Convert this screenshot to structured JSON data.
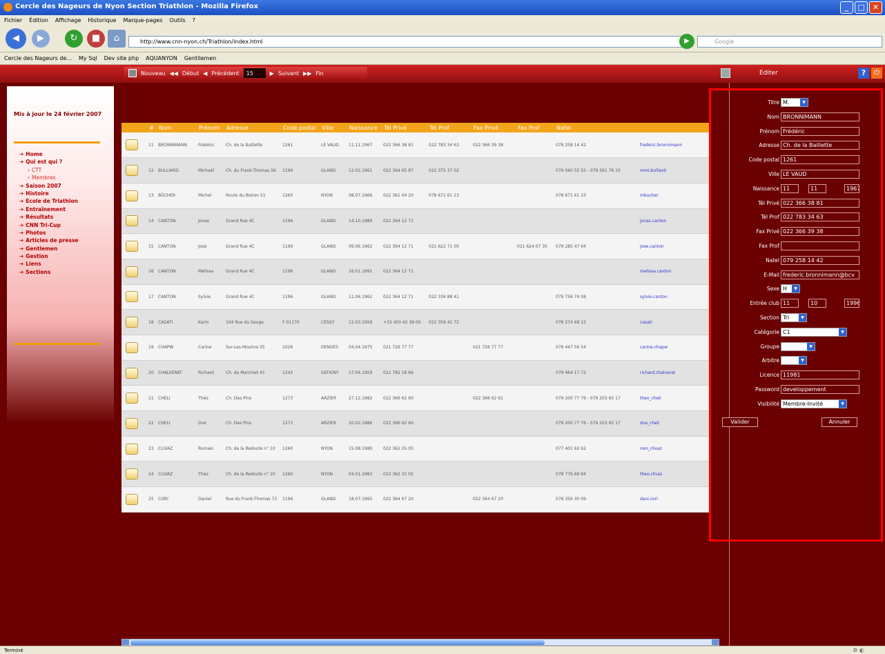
{
  "window": {
    "title": "Cercle des Nageurs de Nyon Section Triathlon - Mozilla Firefox"
  },
  "menu": [
    "Fichier",
    "Édition",
    "Affichage",
    "Historique",
    "Marque-pages",
    "Outils",
    "?"
  ],
  "navigation": {
    "url": "http://www.cnn-nyon.ch/Triathlon/index.html",
    "search_placeholder": "Google"
  },
  "bookmarks": [
    "Cercle des Nageurs de...",
    "My Sql",
    "Dev site php",
    "AQUANYON",
    "Gentilemen"
  ],
  "toolbar": {
    "nouveau": "Nouveau",
    "debut": "Début",
    "precedent": "Précédent",
    "page_size": "15",
    "suivant": "Suivant",
    "fin": "Fin",
    "edit_label": "Editer",
    "help": "?"
  },
  "sidebar": {
    "updated": "Mis à jour le 24 février 2007",
    "items": [
      {
        "label": "Home",
        "sub": false
      },
      {
        "label": "Qui est qui ?",
        "sub": false
      },
      {
        "label": "CTT",
        "sub": true
      },
      {
        "label": "Membres",
        "sub": true
      },
      {
        "label": "Saison 2007",
        "sub": false
      },
      {
        "label": "Histoire",
        "sub": false
      },
      {
        "label": "Ecole de Triathlon",
        "sub": false
      },
      {
        "label": "Entraînement",
        "sub": false
      },
      {
        "label": "Résultats",
        "sub": false
      },
      {
        "label": "CNN Tri-Cup",
        "sub": false
      },
      {
        "label": "Photos",
        "sub": false
      },
      {
        "label": "Articles de presse",
        "sub": false
      },
      {
        "label": "Gentlemen",
        "sub": false
      },
      {
        "label": "Gestion",
        "sub": false
      },
      {
        "label": "Liens",
        "sub": false
      },
      {
        "label": "Sections",
        "sub": false
      }
    ]
  },
  "table": {
    "headers": [
      "",
      "#",
      "Nom",
      "Prénom",
      "Adresse",
      "Code postal",
      "Ville",
      "Naissance",
      "Tél Privé",
      "Tél Prof",
      "Fax Privé",
      "Fax Prof",
      "Natel",
      ""
    ],
    "rows": [
      [
        "11",
        "BRONNIMANN",
        "Frédéric",
        "Ch. de la Baillette",
        "1261",
        "LE VAUD",
        "11.11.1967",
        "022 366 38 81",
        "022 783 34 63",
        "022 366 39 38",
        "",
        "079 258 14 42",
        "frederic.bronnimann"
      ],
      [
        "12",
        "BULLIARD",
        "Michaël",
        "Ch. du Frank-Thomas 56",
        "1196",
        "GLAND",
        "12.02.1961",
        "022 364 65 87",
        "022 375 37 02",
        "",
        "",
        "079 560 55 52 - 079 561 76 10",
        "mmi.bulliard"
      ],
      [
        "13",
        "BÜCHER",
        "Michel",
        "Route du Boiron 51",
        "1260",
        "NYON",
        "08.07.1966",
        "022 361 04 20",
        "078 671 61 23",
        "",
        "",
        "078 671 61 23",
        "mbucher"
      ],
      [
        "14",
        "CANTON",
        "Jonas",
        "Grand Rue 4C",
        "1196",
        "GLAND",
        "14.10.1989",
        "022 364 12 71",
        "",
        "",
        "",
        "",
        "jonas.canton"
      ],
      [
        "15",
        "CANTON",
        "José",
        "Grand Rue 4C",
        "1196",
        "GLAND",
        "09.06.1962",
        "022 364 12 71",
        "021 622 71 00",
        "",
        "021 624 07 35",
        "079 285 47 64",
        "jose.canton"
      ],
      [
        "16",
        "CANTON",
        "Mélissa",
        "Grand Rue 4C",
        "1196",
        "GLAND",
        "16.01.1991",
        "022 364 12 71",
        "",
        "",
        "",
        "",
        "melissa.canton"
      ],
      [
        "17",
        "CANTON",
        "Sylvie",
        "Grand Rue 4C",
        "1196",
        "GLAND",
        "11.06.1962",
        "022 364 12 71",
        "022 336 88 41",
        "",
        "",
        "079 756 74 08",
        "sylvie.canton"
      ],
      [
        "18",
        "CASATI",
        "Karin",
        "104 Rue du Sauge",
        "F-01170",
        "CESSY",
        "12.03.1959",
        "+33 450 42 39 00",
        "022 359 41 72",
        "",
        "",
        "078 274 69 12",
        "casati"
      ],
      [
        "19",
        "CHAPW",
        "Carine",
        "Sur-Les-Moulins 35",
        "1026",
        "DENGES",
        "04.04.1975",
        "021 726 77 77",
        "",
        "021 726 77 77",
        "",
        "079 447 56 54",
        "carine.chapw"
      ],
      [
        "20",
        "CHALVERAT",
        "Richard",
        "Ch. de Marcinet 41",
        "1242",
        "SATIGNY",
        "17.04.1959",
        "022 782 16 66",
        "",
        "",
        "",
        "079 464 17 72",
        "richard.chalverat"
      ],
      [
        "21",
        "CHELI",
        "Théo",
        "Ch. Des Pins",
        "1273",
        "ARZIER",
        "27.12.1982",
        "022 366 62 60",
        "",
        "022 366 62 61",
        "",
        "079 200 77 76 - 079 203 65 17",
        "theo_cheli"
      ],
      [
        "22",
        "CHELI",
        "Dvé",
        "Ch. Des Pins",
        "1273",
        "ARZIER",
        "20.02.1986",
        "022 366 62 60",
        "",
        "",
        "",
        "079 200 77 76 - 079 203 65 17",
        "dve_cheli"
      ],
      [
        "23",
        "CLIVAZ",
        "Romain",
        "Ch. de la Redoute n° 10",
        "1260",
        "NYON",
        "15.08.1980",
        "022 362 25 05",
        "",
        "",
        "",
        "077 401 62 62",
        "rom_clivaz"
      ],
      [
        "24",
        "CLIVAZ",
        "Théo",
        "Ch. de la Redoute n° 10",
        "1260",
        "NYON",
        "04.01.1983",
        "022 362 25 05",
        "",
        "",
        "",
        "078 776 69 94",
        "theo.clivaz"
      ],
      [
        "25",
        "CORI",
        "Daniel",
        "Rue du Frank-Thomas 73",
        "1196",
        "GLAND",
        "18.07.1965",
        "022 364 67 20",
        "",
        "022 364 67 20",
        "",
        "078 356 30 09",
        "dani.cori"
      ]
    ]
  },
  "form": {
    "titre": {
      "label": "Titre",
      "value": "M."
    },
    "nom": {
      "label": "Nom",
      "value": "BRONNIMANN"
    },
    "prenom": {
      "label": "Prénom",
      "value": "Frédéric"
    },
    "adresse": {
      "label": "Adresse",
      "value": "Ch. de la Baillette"
    },
    "code_postal": {
      "label": "Code postal",
      "value": "1261"
    },
    "ville": {
      "label": "Ville",
      "value": "LE VAUD"
    },
    "naissance": {
      "label": "Naissance",
      "day": "11",
      "month": "11",
      "year": "1967"
    },
    "tel_prive": {
      "label": "Tél Privé",
      "value": "022 366 38 81"
    },
    "tel_prof": {
      "label": "Tél Prof",
      "value": "022 783 34 63"
    },
    "fax_prive": {
      "label": "Fax Privé",
      "value": "022 366 39 38"
    },
    "fax_prof": {
      "label": "Fax Prof",
      "value": ""
    },
    "natel": {
      "label": "Natel",
      "value": "079 258 14 42"
    },
    "email": {
      "label": "E-Mail",
      "value": "frederic.bronnimann@bcv"
    },
    "sexe": {
      "label": "Sexe",
      "value": "H"
    },
    "entree_club": {
      "label": "Entrée club",
      "day": "11",
      "month": "10",
      "year": "1996"
    },
    "section": {
      "label": "Section",
      "value": "Tri"
    },
    "categorie": {
      "label": "Catégorie",
      "value": "C1"
    },
    "groupe": {
      "label": "Groupe",
      "value": ""
    },
    "arbitre": {
      "label": "Arbitre",
      "value": ""
    },
    "licence": {
      "label": "Licence",
      "value": "11981"
    },
    "password": {
      "label": "Password",
      "value": "developpement"
    },
    "visibilite": {
      "label": "Visibilité",
      "value": "Membre-Invité"
    },
    "valider": "Valider",
    "annuler": "Annuler"
  },
  "status": {
    "text": "Terminé"
  },
  "colors": {
    "app_bg": "#6a0000",
    "header_orange": "#f2a41a",
    "toolbar_red": "#c01818",
    "highlight_red": "#ff0000"
  }
}
